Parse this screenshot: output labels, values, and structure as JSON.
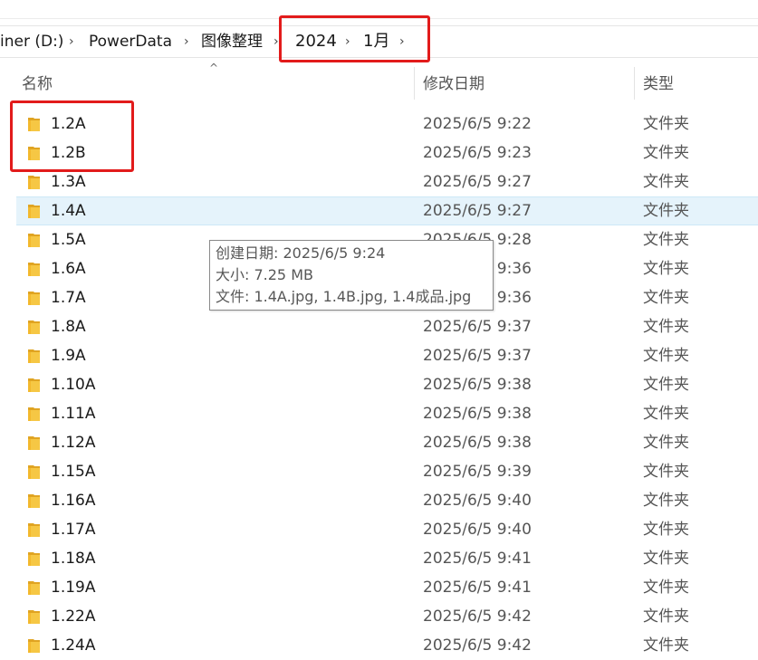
{
  "breadcrumb": {
    "items": [
      "iner (D:)",
      "PowerData",
      "图像整理",
      "2024",
      "1月"
    ],
    "separator": "›",
    "expand": "›"
  },
  "columns": {
    "name": "名称",
    "date": "修改日期",
    "type": "类型",
    "sort_indicator": "^"
  },
  "files": [
    {
      "name": "1.2A",
      "date": "2025/6/5 9:22",
      "type": "文件夹"
    },
    {
      "name": "1.2B",
      "date": "2025/6/5 9:23",
      "type": "文件夹"
    },
    {
      "name": "1.3A",
      "date": "2025/6/5 9:27",
      "type": "文件夹"
    },
    {
      "name": "1.4A",
      "date": "2025/6/5 9:27",
      "type": "文件夹"
    },
    {
      "name": "1.5A",
      "date": "2025/6/5 9:28",
      "type": "文件夹"
    },
    {
      "name": "1.6A",
      "date": "2025/6/5 9:36",
      "type": "文件夹"
    },
    {
      "name": "1.7A",
      "date": "2025/6/5 9:36",
      "type": "文件夹"
    },
    {
      "name": "1.8A",
      "date": "2025/6/5 9:37",
      "type": "文件夹"
    },
    {
      "name": "1.9A",
      "date": "2025/6/5 9:37",
      "type": "文件夹"
    },
    {
      "name": "1.10A",
      "date": "2025/6/5 9:38",
      "type": "文件夹"
    },
    {
      "name": "1.11A",
      "date": "2025/6/5 9:38",
      "type": "文件夹"
    },
    {
      "name": "1.12A",
      "date": "2025/6/5 9:38",
      "type": "文件夹"
    },
    {
      "name": "1.15A",
      "date": "2025/6/5 9:39",
      "type": "文件夹"
    },
    {
      "name": "1.16A",
      "date": "2025/6/5 9:40",
      "type": "文件夹"
    },
    {
      "name": "1.17A",
      "date": "2025/6/5 9:40",
      "type": "文件夹"
    },
    {
      "name": "1.18A",
      "date": "2025/6/5 9:41",
      "type": "文件夹"
    },
    {
      "name": "1.19A",
      "date": "2025/6/5 9:41",
      "type": "文件夹"
    },
    {
      "name": "1.22A",
      "date": "2025/6/5 9:42",
      "type": "文件夹"
    },
    {
      "name": "1.24A",
      "date": "2025/6/5 9:42",
      "type": "文件夹"
    }
  ],
  "tooltip": {
    "created": "创建日期: 2025/6/5 9:24",
    "size": "大小: 7.25 MB",
    "files": "文件: 1.4A.jpg, 1.4B.jpg, 1.4成品.jpg"
  },
  "colors": {
    "highlight_box": "#e21b1b",
    "selected_row": "#e5f3fb",
    "folder": "#f3c03f"
  },
  "icons": {
    "folder": "folder-icon",
    "separator": "chevron-right-icon"
  }
}
